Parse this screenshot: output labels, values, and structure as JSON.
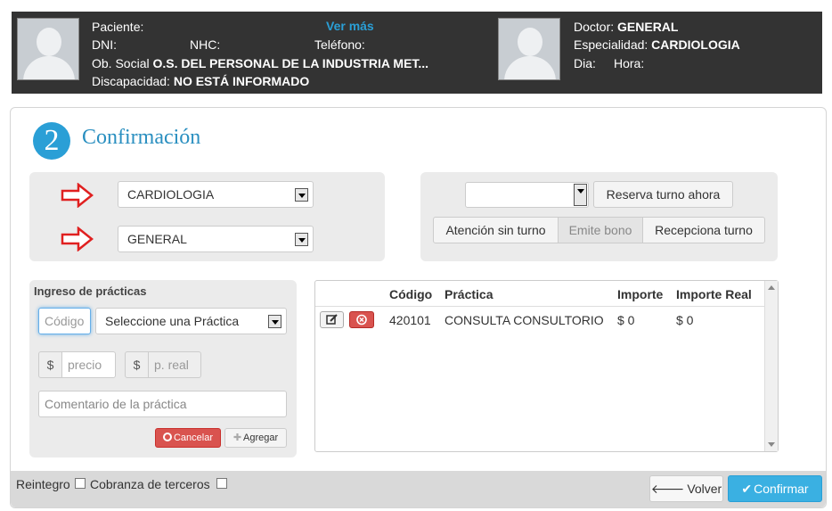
{
  "patient": {
    "paciente_label": "Paciente:",
    "ver_mas": "Ver más",
    "dni_label": "DNI:",
    "nhc_label": "NHC:",
    "telefono_label": "Teléfono:",
    "obsocial_label": "Ob. Social",
    "obsocial_value": "O.S. DEL PERSONAL DE LA INDUSTRIA MET...",
    "discapacidad_label": "Discapacidad:",
    "discapacidad_value": "NO ESTÁ INFORMADO"
  },
  "doctor": {
    "doctor_label": "Doctor:",
    "doctor_value": "GENERAL",
    "especialidad_label": "Especialidad:",
    "especialidad_value": "CARDIOLOGIA",
    "dia_label": "Dia:",
    "hora_label": "Hora:"
  },
  "step": {
    "number": "2",
    "title": "Confirmación"
  },
  "selection": {
    "especialidad_selected": "CARDIOLOGIA",
    "doctor_selected": "GENERAL"
  },
  "turno": {
    "select_value": "",
    "reserva_button": "Reserva turno ahora",
    "atencion_button": "Atención sin turno",
    "emite_bono_button": "Emite bono",
    "recepciona_button": "Recepciona turno"
  },
  "practicas_form": {
    "title": "Ingreso de prácticas",
    "codigo_placeholder": "Código",
    "practica_select": "Seleccione una Práctica",
    "currency": "$",
    "precio_placeholder": "precio",
    "preal_placeholder": "p. real",
    "comentario_placeholder": "Comentario de la práctica",
    "cancelar_button": "Cancelar",
    "agregar_button": "Agregar"
  },
  "practicas_table": {
    "headers": {
      "codigo": "Código",
      "practica": "Práctica",
      "importe": "Importe",
      "importe_real": "Importe Real"
    },
    "rows": [
      {
        "codigo": "420101",
        "practica": "CONSULTA CONSULTORIO",
        "importe": "$ 0",
        "importe_real": "$ 0"
      }
    ]
  },
  "footer": {
    "reintegro_label": "Reintegro",
    "cobranza_label": "Cobranza de terceros",
    "volver_button": "Volver",
    "confirmar_button": "Confirmar"
  },
  "colors": {
    "accent": "#2a9fd6",
    "danger": "#d9534f",
    "header_bg": "#333333",
    "arrow": "#e02020"
  }
}
